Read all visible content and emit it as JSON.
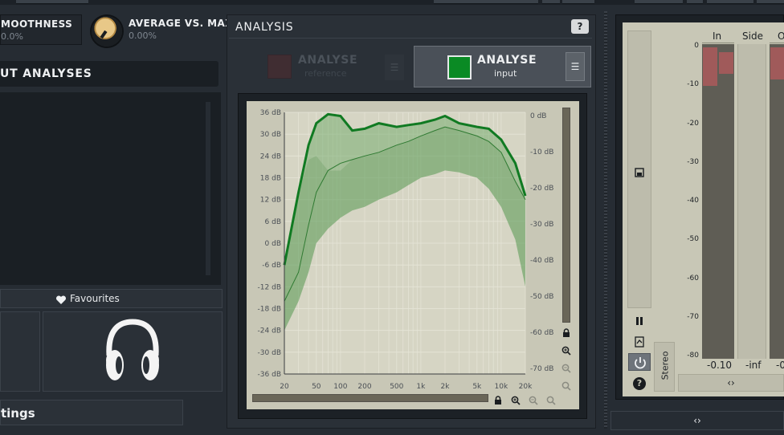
{
  "top_left": {
    "smoothness_label": "MOOTHNESS",
    "smoothness_value": "0.0%",
    "avg_max_label": "AVERAGE VS. MAX",
    "avg_max_value": "0.00%",
    "section_title": "UT ANALYSES",
    "favourites": "Favourites",
    "settings": "tings"
  },
  "analysis": {
    "title": "ANALYSIS",
    "help": "?",
    "ref_label": "ANALYSE",
    "ref_sub": "reference",
    "input_label": "ANALYSE",
    "input_sub": "input",
    "menu": "☰"
  },
  "chart_data": {
    "type": "area",
    "x_ticks": [
      "20",
      "50",
      "100",
      "200",
      "500",
      "1k",
      "2k",
      "5k",
      "10k",
      "20k"
    ],
    "y_left_ticks": [
      "36 dB",
      "30 dB",
      "24 dB",
      "18 dB",
      "12 dB",
      "6 dB",
      "0 dB",
      "-6 dB",
      "-12 dB",
      "-18 dB",
      "-24 dB",
      "-30 dB",
      "-36 dB"
    ],
    "y_right_ticks": [
      "0 dB",
      "-10 dB",
      "-20 dB",
      "-30 dB",
      "-40 dB",
      "-50 dB",
      "-60 dB",
      "-70 dB"
    ],
    "ylim": [
      -36,
      36
    ],
    "x_scale": "log",
    "xlim": [
      20,
      20000
    ],
    "series": [
      {
        "x": [
          20,
          30,
          40,
          50,
          70,
          100,
          140,
          200,
          300,
          500,
          700,
          1000,
          1500,
          2000,
          3000,
          5000,
          7000,
          10000,
          15000,
          20000
        ],
        "y": [
          -6,
          14,
          27,
          33,
          35.5,
          35,
          31,
          31.5,
          33,
          32,
          32.5,
          33,
          34,
          35,
          33,
          32,
          31.5,
          28.5,
          22,
          13
        ]
      },
      {
        "x": [
          20,
          30,
          40,
          50,
          70,
          100,
          140,
          200,
          300,
          500,
          700,
          1000,
          1500,
          2000,
          3000,
          5000,
          7000,
          10000,
          15000,
          20000
        ],
        "y": [
          -16,
          -8,
          5,
          14,
          20,
          22,
          23,
          24,
          25,
          27,
          28,
          29.5,
          31,
          32,
          31,
          29.5,
          28,
          25,
          17,
          12
        ]
      }
    ],
    "band_upper": [
      -6,
      14,
      23,
      24,
      20,
      20,
      23,
      24,
      25,
      27,
      28,
      29.5,
      31,
      32,
      31,
      29.5,
      28,
      25,
      17,
      12
    ],
    "band_lower": [
      -24,
      -16,
      -8,
      0,
      4,
      7,
      9,
      10,
      12,
      14,
      16,
      18,
      19,
      20,
      19.5,
      18,
      15,
      10,
      1,
      -12
    ]
  },
  "meters": {
    "cols": [
      "In",
      "Side",
      "O"
    ],
    "scale": [
      "0",
      "-10",
      "-20",
      "-30",
      "-40",
      "-50",
      "-60",
      "-70",
      "-80"
    ],
    "in_value": "-0.10",
    "side_value": "-inf",
    "out_value": "-0",
    "stereo": "Stereo",
    "in_level_db": [
      -10,
      -4
    ],
    "arrows": "‹›",
    "bottom_arrows": "‹›"
  },
  "colors": {
    "accent_green": "#0a8a24",
    "band_green": "#6fa86b",
    "panel_bg": "#c8c7b6"
  },
  "icons": [
    "lock-icon",
    "zoom-in-icon",
    "zoom-out-icon",
    "zoom-fit-icon",
    "pause-icon",
    "power-icon",
    "help-icon",
    "headphones-icon",
    "heart-icon",
    "menu-icon",
    "save-icon"
  ]
}
